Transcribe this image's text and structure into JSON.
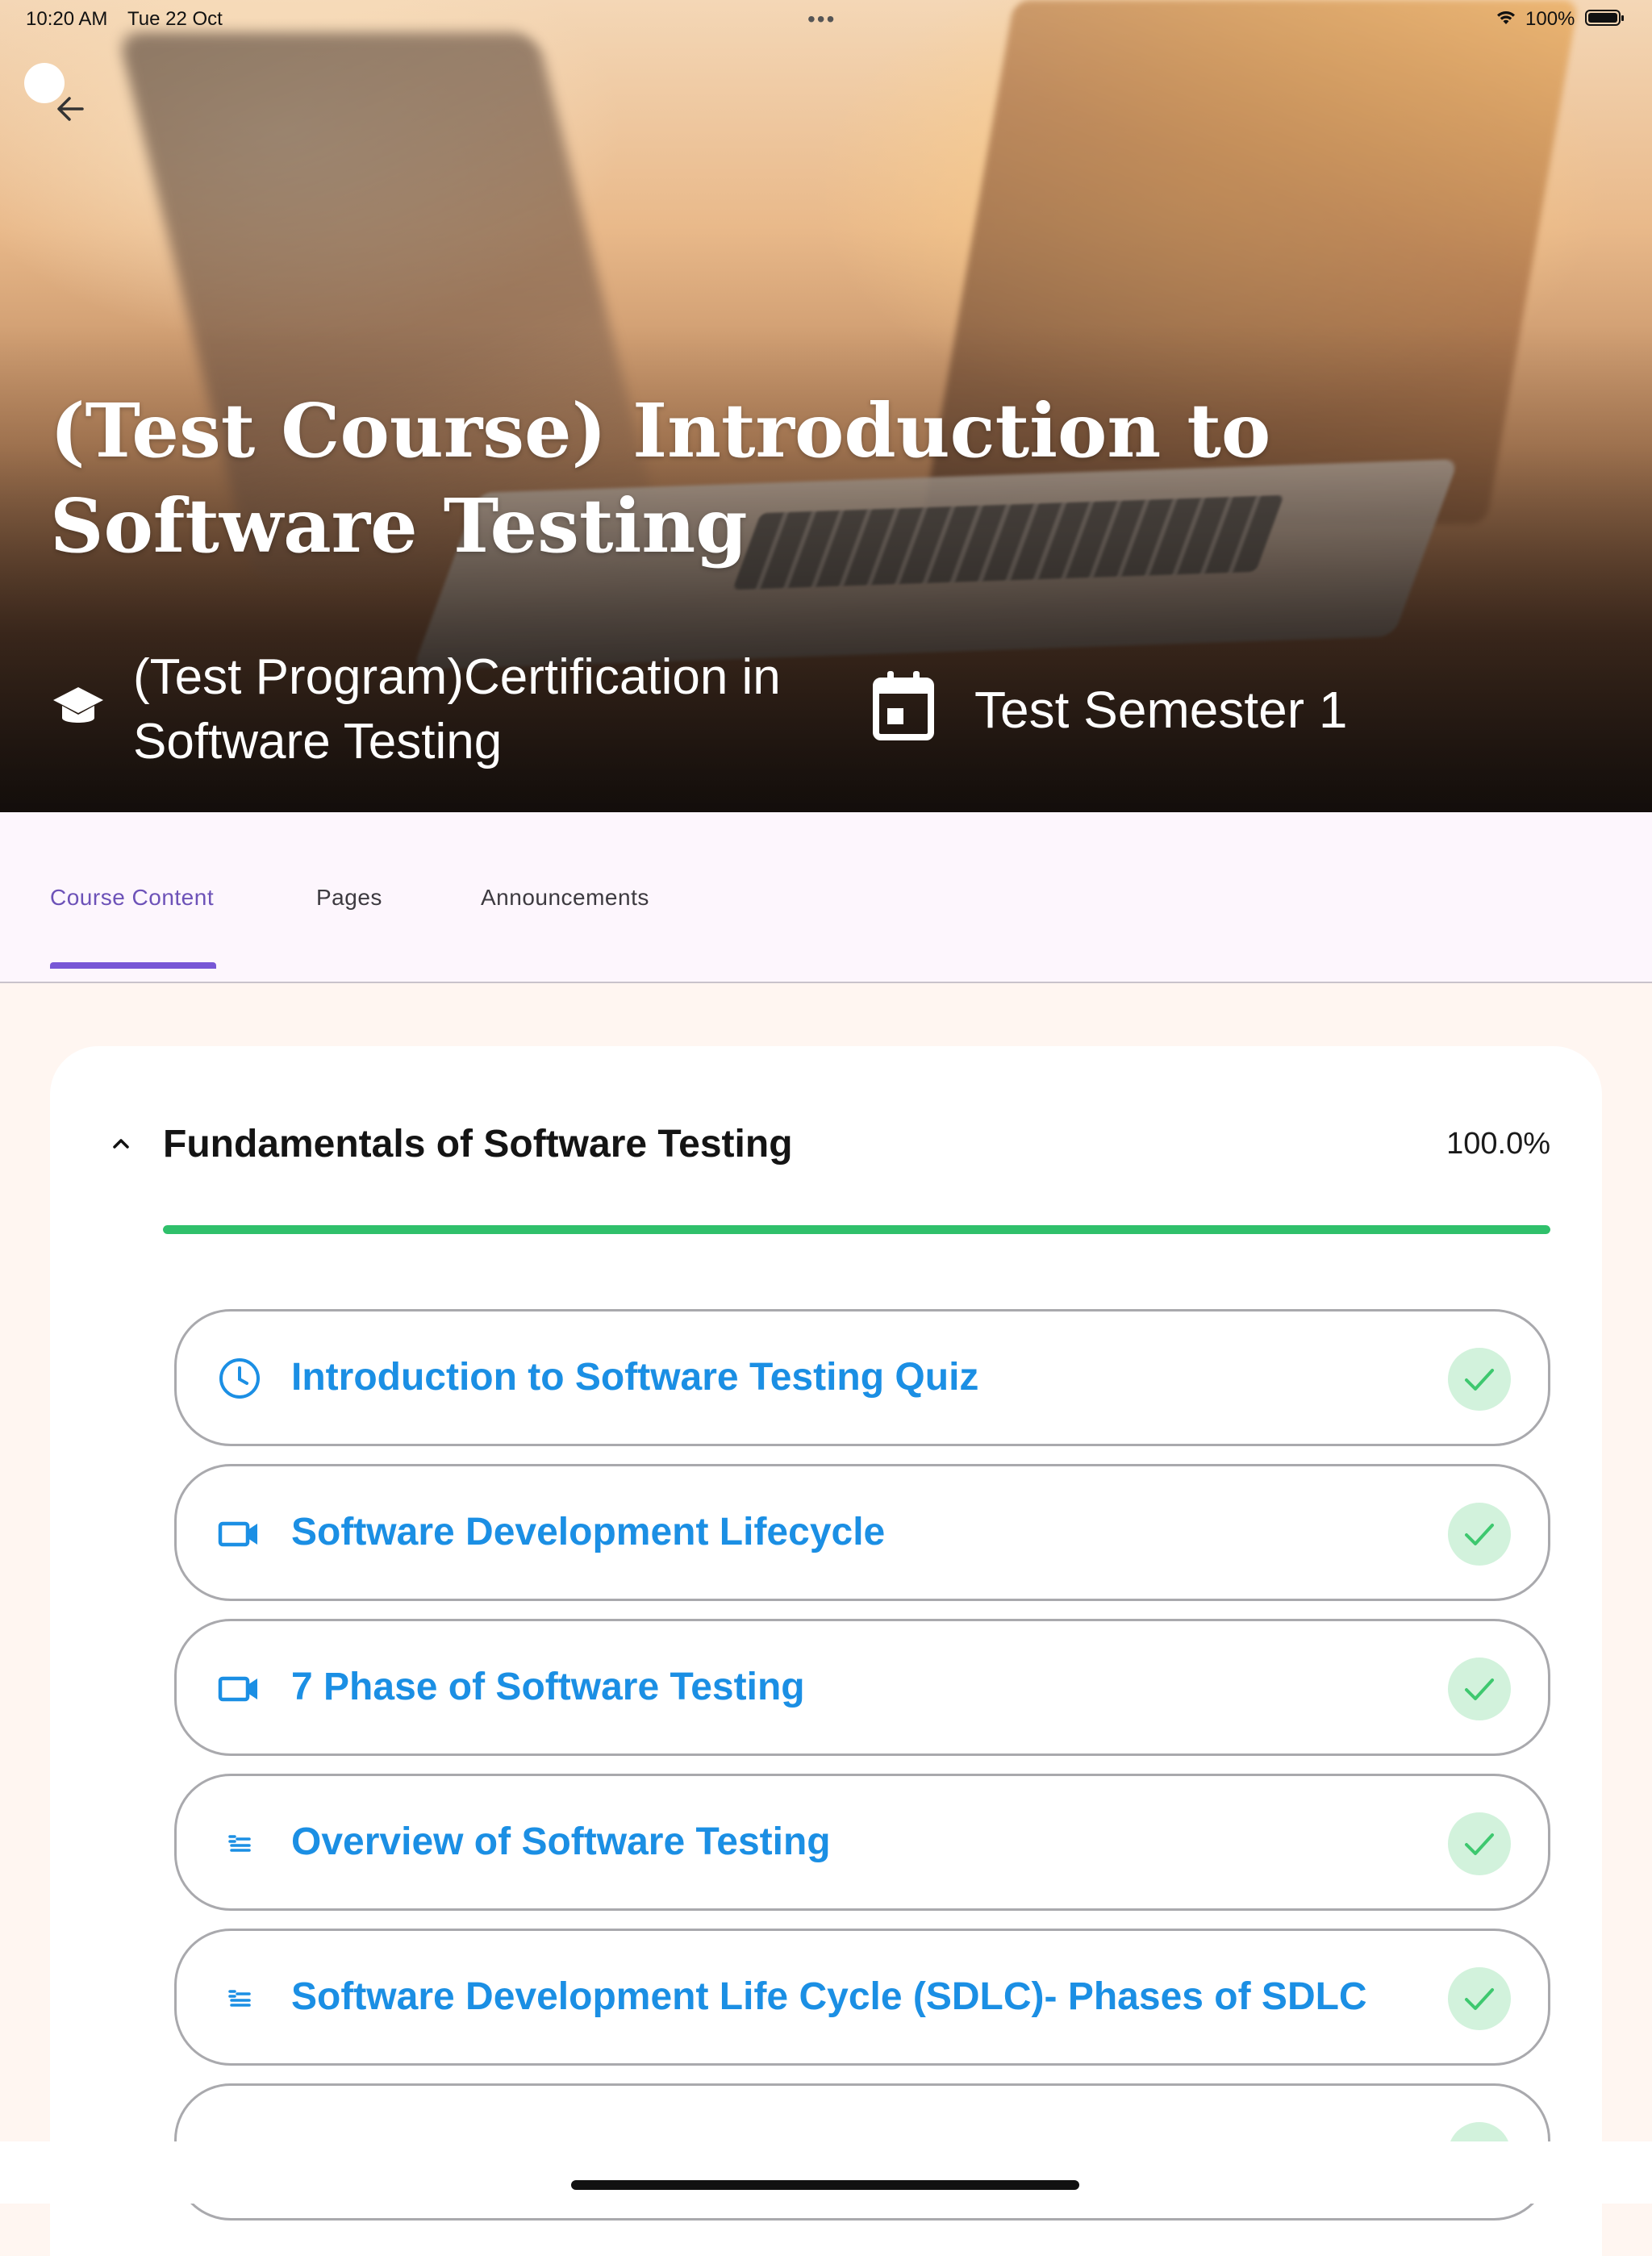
{
  "status_bar": {
    "time": "10:20 AM",
    "date": "Tue 22 Oct",
    "battery": "100%"
  },
  "hero": {
    "title": "(Test Course) Introduction to Software Testing",
    "program": "(Test Program)Certification in Software Testing",
    "semester": "Test Semester 1"
  },
  "tabs": [
    {
      "label": "Course Content",
      "active": true
    },
    {
      "label": "Pages",
      "active": false
    },
    {
      "label": "Announcements",
      "active": false
    }
  ],
  "module": {
    "title": "Fundamentals of Software Testing",
    "progress_text": "100.0%",
    "progress": 1.0,
    "lessons": [
      {
        "label": "Introduction to Software Testing Quiz",
        "icon": "clock-icon",
        "completed": true
      },
      {
        "label": "Software Development Lifecycle",
        "icon": "video-icon",
        "completed": true
      },
      {
        "label": "7 Phase of Software Testing",
        "icon": "video-icon",
        "completed": true
      },
      {
        "label": "Overview of Software Testing",
        "icon": "text-lines-icon",
        "completed": true
      },
      {
        "label": "Software Development Life Cycle (SDLC)- Phases of SDLC",
        "icon": "text-lines-icon",
        "completed": true
      }
    ]
  },
  "colors": {
    "accent": "#7757d6",
    "lesson_text": "#1b8fe4",
    "progress": "#2fc06b",
    "check_bg": "#d2f2dc"
  }
}
